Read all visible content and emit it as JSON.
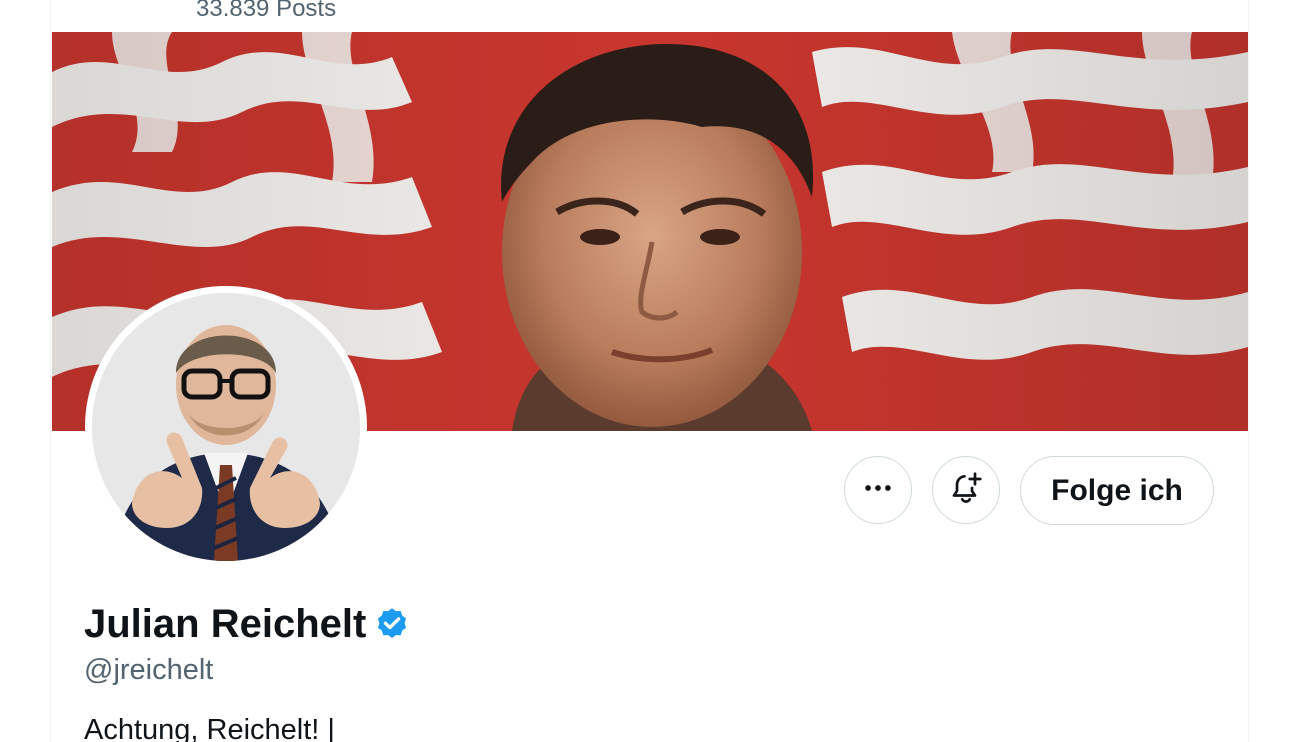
{
  "header": {
    "post_count": "33.839 Posts"
  },
  "profile": {
    "display_name": "Julian Reichelt",
    "handle": "@jreichelt",
    "bio_first_line": "Achtung, Reichelt! |",
    "verified": true
  },
  "actions": {
    "more_icon": "more-horizontal-icon",
    "bell_icon": "bell-plus-icon",
    "follow_label": "Folge ich"
  },
  "colors": {
    "verified_blue": "#1d9bf0",
    "text_primary": "#0f1419",
    "text_secondary": "#536471",
    "button_border": "#cfd9de"
  }
}
